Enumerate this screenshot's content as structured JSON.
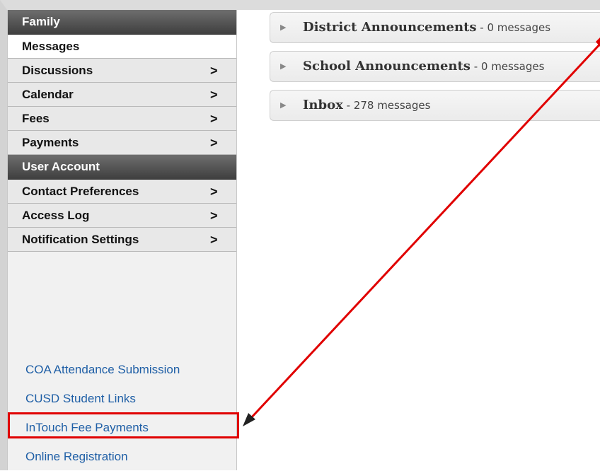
{
  "sidebar": {
    "family_header": "Family",
    "family_items": [
      {
        "label": "Messages",
        "chevron": ""
      },
      {
        "label": "Discussions",
        "chevron": ">"
      },
      {
        "label": "Calendar",
        "chevron": ">"
      },
      {
        "label": "Fees",
        "chevron": ">"
      },
      {
        "label": "Payments",
        "chevron": ">"
      }
    ],
    "account_header": "User Account",
    "account_items": [
      {
        "label": "Contact Preferences",
        "chevron": ">"
      },
      {
        "label": "Access Log",
        "chevron": ">"
      },
      {
        "label": "Notification Settings",
        "chevron": ">"
      }
    ],
    "links": [
      "COA Attendance Submission",
      "CUSD Student Links",
      "InTouch Fee Payments",
      "Online Registration"
    ]
  },
  "panels": [
    {
      "title": "District Announcements",
      "count": " - 0 messages"
    },
    {
      "title": "School Announcements",
      "count": " - 0 messages"
    },
    {
      "title": "Inbox",
      "count": " - 278 messages"
    }
  ],
  "colors": {
    "annotation": "#e00000",
    "link": "#1f5fa6"
  },
  "icons": {
    "chevron": "chevron-right-icon",
    "expand": "triangle-right-icon"
  }
}
